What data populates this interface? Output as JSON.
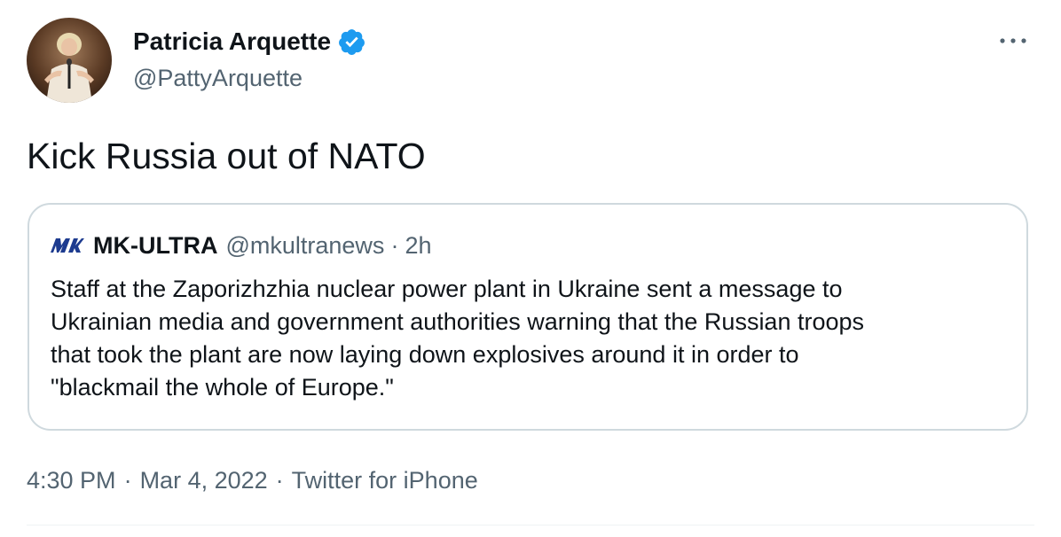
{
  "author": {
    "name": "Patricia Arquette",
    "handle": "@PattyArquette",
    "verified": true
  },
  "tweet": {
    "text": "Kick Russia out of NATO"
  },
  "quoted_tweet": {
    "logo_icon": "mk-ultra-logo-icon",
    "name": "MK-ULTRA",
    "handle": "@mkultranews",
    "separator": "·",
    "time": "2h",
    "lines": [
      "Staff at the Zaporizhzhia nuclear power plant in Ukraine sent a message to",
      "Ukrainian media and government authorities warning that the Russian troops",
      "that took the plant are now laying down explosives around it in order to",
      "\"blackmail the whole of Europe.\""
    ]
  },
  "meta": {
    "time": "4:30 PM",
    "separator": "·",
    "date": "Mar 4, 2022",
    "source": "Twitter for iPhone"
  },
  "colors": {
    "accent": "#1d9bf0",
    "text_primary": "#0f1419",
    "text_secondary": "#536471",
    "border": "#cfd9de",
    "logo": "#1d3b8f"
  },
  "icons": {
    "verified": "verified-badge-icon",
    "more": "more-options-icon"
  }
}
